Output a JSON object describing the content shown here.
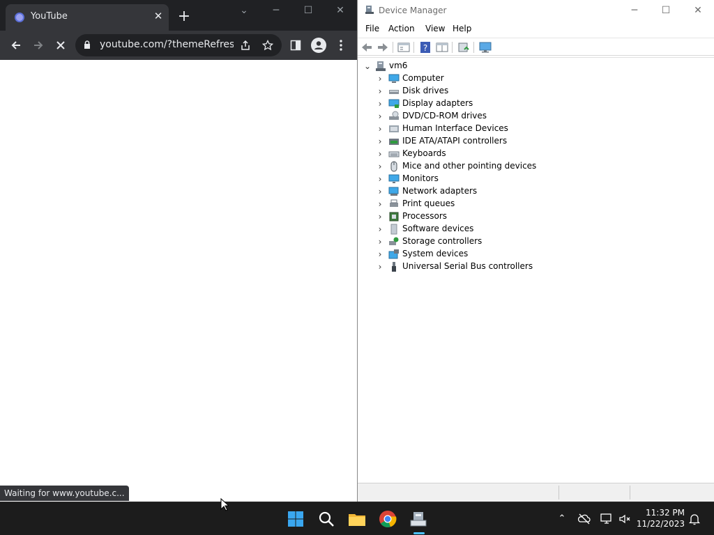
{
  "chrome": {
    "tab_title": "YouTube",
    "tab_close": "✕",
    "new_tab": "+",
    "url": "youtube.com/?themeRefresh...",
    "status": "Waiting for www.youtube.c...",
    "win_min": "─",
    "win_max": "☐",
    "win_close": "✕",
    "tab_search": "⌄"
  },
  "devmgr": {
    "title": "Device Manager",
    "menu": [
      "File",
      "Action",
      "View",
      "Help"
    ],
    "root": "vm6",
    "items": [
      {
        "label": "Computer",
        "icon": "computer-icon"
      },
      {
        "label": "Disk drives",
        "icon": "disk-drive-icon"
      },
      {
        "label": "Display adapters",
        "icon": "display-adapter-icon"
      },
      {
        "label": "DVD/CD-ROM drives",
        "icon": "dvd-drive-icon"
      },
      {
        "label": "Human Interface Devices",
        "icon": "hid-icon"
      },
      {
        "label": "IDE ATA/ATAPI controllers",
        "icon": "ide-controller-icon"
      },
      {
        "label": "Keyboards",
        "icon": "keyboard-icon"
      },
      {
        "label": "Mice and other pointing devices",
        "icon": "mouse-icon"
      },
      {
        "label": "Monitors",
        "icon": "monitor-icon"
      },
      {
        "label": "Network adapters",
        "icon": "network-adapter-icon"
      },
      {
        "label": "Print queues",
        "icon": "printer-icon"
      },
      {
        "label": "Processors",
        "icon": "processor-icon"
      },
      {
        "label": "Software devices",
        "icon": "software-device-icon"
      },
      {
        "label": "Storage controllers",
        "icon": "storage-controller-icon"
      },
      {
        "label": "System devices",
        "icon": "system-device-icon"
      },
      {
        "label": "Universal Serial Bus controllers",
        "icon": "usb-icon"
      }
    ]
  },
  "taskbar": {
    "time": "11:32 PM",
    "date": "11/22/2023"
  },
  "colors": {
    "chrome_dark": "#202124",
    "chrome_toolbar": "#35363a",
    "taskbar": "#1c1c1c",
    "accent": "#4cc2ff"
  }
}
